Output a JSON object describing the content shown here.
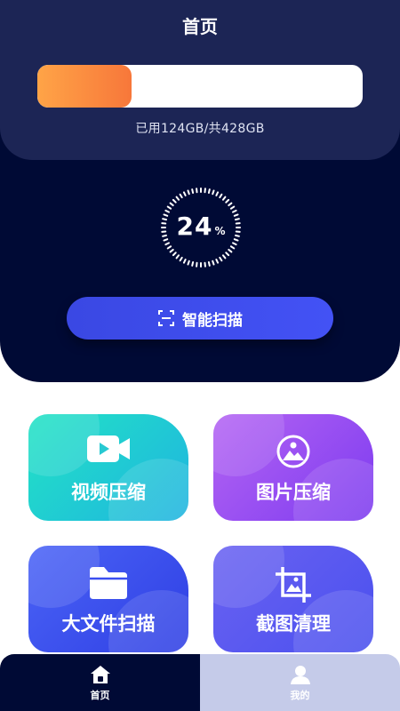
{
  "header": {
    "title": "首页"
  },
  "storage": {
    "used_fraction": 0.29,
    "usage_text": "已用124GB/共428GB"
  },
  "gauge": {
    "percent_value": "24",
    "percent_unit": "%"
  },
  "scan_button": {
    "label": "智能扫描",
    "icon": "scan-frame-icon"
  },
  "features": [
    {
      "label": "视频压缩",
      "icon": "video-camera-icon"
    },
    {
      "label": "图片压缩",
      "icon": "image-icon"
    },
    {
      "label": "大文件扫描",
      "icon": "folder-icon"
    },
    {
      "label": "截图清理",
      "icon": "crop-image-icon"
    }
  ],
  "tabbar": {
    "items": [
      {
        "label": "首页",
        "icon": "home-icon",
        "active": true
      },
      {
        "label": "我的",
        "icon": "user-icon",
        "active": false
      }
    ]
  },
  "colors": {
    "hero_bg": "#000a35",
    "hero_top_bg": "#1c2555",
    "progress_start": "#ffa447",
    "progress_end": "#f7773a",
    "scan_button": "#4352f5",
    "card_video": "#22e3c5",
    "card_image": "#9a4ff2",
    "card_files": "#3d51ee",
    "card_clean": "#5a58f0",
    "tab_inactive": "#c5cbe9"
  }
}
